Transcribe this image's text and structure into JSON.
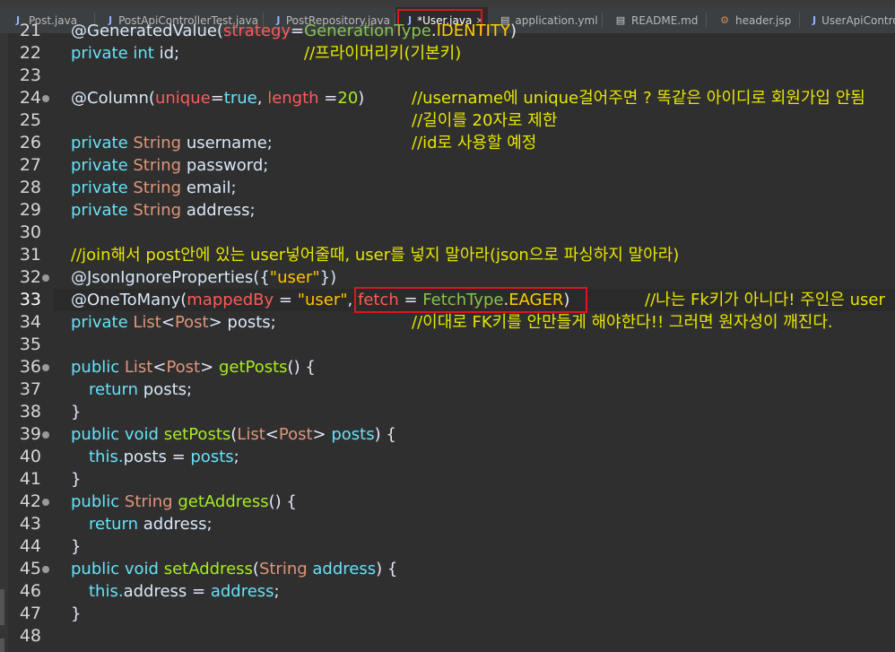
{
  "tabs": [
    {
      "label": "Post.java",
      "icon": "java-file-icon",
      "active": false
    },
    {
      "label": "PostApiControllerTest.java",
      "icon": "java-file-icon",
      "active": false
    },
    {
      "label": "PostRepository.java",
      "icon": "java-file-icon",
      "active": false
    },
    {
      "label": "*User.java",
      "icon": "java-file-icon",
      "active": true
    },
    {
      "label": "application.yml",
      "icon": "text-file-icon",
      "active": false
    },
    {
      "label": "README.md",
      "icon": "text-file-icon",
      "active": false
    },
    {
      "label": "header.jsp",
      "icon": "jsp-file-icon",
      "active": false
    },
    {
      "label": "UserApiContro",
      "icon": "java-file-icon",
      "active": false
    }
  ],
  "close_glyph": "×",
  "editor": {
    "current_line": 33,
    "lines": [
      {
        "n": "21",
        "text": "@GeneratedValue(strategy=GenerationType.IDENTITY)"
      },
      {
        "n": "22",
        "text": "private int id;                    //프라이머리키(기본키)"
      },
      {
        "n": "23",
        "text": ""
      },
      {
        "n": "24",
        "text": "@Column(unique=true, length =20)        //username에 unique걸어주면 ? 똑같은 아이디로 회원가입 안됨"
      },
      {
        "n": "25",
        "text": "                                        //길이를 20자로 제한"
      },
      {
        "n": "26",
        "text": "private String username;                //id로 사용할 예정"
      },
      {
        "n": "27",
        "text": "private String password;"
      },
      {
        "n": "28",
        "text": "private String email;"
      },
      {
        "n": "29",
        "text": "private String address;"
      },
      {
        "n": "30",
        "text": ""
      },
      {
        "n": "31",
        "text": "//join해서 post안에 있는 user넣어줄때, user를 넣지 말아라(json으로 파싱하지 말아라)"
      },
      {
        "n": "32",
        "text": "@JsonIgnoreProperties({\"user\"})"
      },
      {
        "n": "33",
        "text": "@OneToMany(mappedBy = \"user\", fetch = FetchType.EAGER)         //나는 Fk키가 아니다! 주인은 user"
      },
      {
        "n": "34",
        "text": "private List<Post> posts;               //이대로 FK키를 안만들게 해야한다!! 그러면 원자성이 깨진다."
      },
      {
        "n": "35",
        "text": ""
      },
      {
        "n": "36",
        "text": "public List<Post> getPosts() {"
      },
      {
        "n": "37",
        "text": "  return posts;"
      },
      {
        "n": "38",
        "text": "}"
      },
      {
        "n": "39",
        "text": "public void setPosts(List<Post> posts) {"
      },
      {
        "n": "40",
        "text": "  this.posts = posts;"
      },
      {
        "n": "41",
        "text": "}"
      },
      {
        "n": "42",
        "text": "public String getAddress() {"
      },
      {
        "n": "43",
        "text": "  return address;"
      },
      {
        "n": "44",
        "text": "}"
      },
      {
        "n": "45",
        "text": "public void setAddress(String address) {"
      },
      {
        "n": "46",
        "text": "  this.address = address;"
      },
      {
        "n": "47",
        "text": "}"
      },
      {
        "n": "48",
        "text": ""
      }
    ],
    "tokens": {
      "l21": [
        "@GeneratedValue(",
        "strategy",
        "=",
        "GenerationType",
        ".",
        "IDENTITY",
        ")"
      ],
      "l22": [
        "private int ",
        "id",
        ";",
        "//프라이머리키(기본키)"
      ],
      "l24": [
        "@Column(",
        "unique",
        "=",
        "true",
        ", ",
        "length",
        " =",
        "20",
        ")",
        "//username에 unique걸어주면 ? 똑같은 아이디로 회원가입 안됨"
      ],
      "l25": [
        "//길이를 20자로 제한"
      ],
      "l26": [
        "private ",
        "String",
        " username;",
        "//id로 사용할 예정"
      ],
      "l27": [
        "private ",
        "String",
        " password;"
      ],
      "l28": [
        "private ",
        "String",
        " email;"
      ],
      "l29": [
        "private ",
        "String",
        " address;"
      ],
      "l31": [
        "//join해서 post안에 있는 user넣어줄때, user를 넣지 말아라(json으로 파싱하지 말아라)"
      ],
      "l32": [
        "@JsonIgnoreProperties({",
        "\"user\"",
        "})"
      ],
      "l33": [
        "@OneToMany(",
        "mappedBy",
        " = ",
        "\"user\"",
        ", ",
        "fetch",
        " = ",
        "FetchType",
        ".",
        "EAGER",
        ")",
        "//나는 Fk키가 아니다! 주인은 user"
      ],
      "l34": [
        "private ",
        "List",
        "<",
        "Post",
        "> posts;",
        "//이대로 FK키를 안만들게 해야한다!! 그러면 원자성이 깨진다."
      ],
      "l36": [
        "public ",
        "List",
        "<",
        "Post",
        "> ",
        "getPosts",
        "() {"
      ],
      "l37": [
        "return ",
        "posts",
        ";"
      ],
      "l38": [
        "}"
      ],
      "l39": [
        "public void ",
        "setPosts",
        "(",
        "List",
        "<",
        "Post",
        "> ",
        "posts",
        ") {"
      ],
      "l40": [
        "this.",
        "posts",
        " = ",
        "posts",
        ";"
      ],
      "l41": [
        "}"
      ],
      "l42": [
        "public ",
        "String",
        " ",
        "getAddress",
        "() {"
      ],
      "l43": [
        "return ",
        "address",
        ";"
      ],
      "l44": [
        "}"
      ],
      "l45": [
        "public void ",
        "setAddress",
        "(",
        "String",
        " ",
        "address",
        ") {"
      ],
      "l46": [
        "this.",
        "address",
        " = ",
        "address",
        ";"
      ],
      "l47": [
        "}"
      ]
    }
  }
}
